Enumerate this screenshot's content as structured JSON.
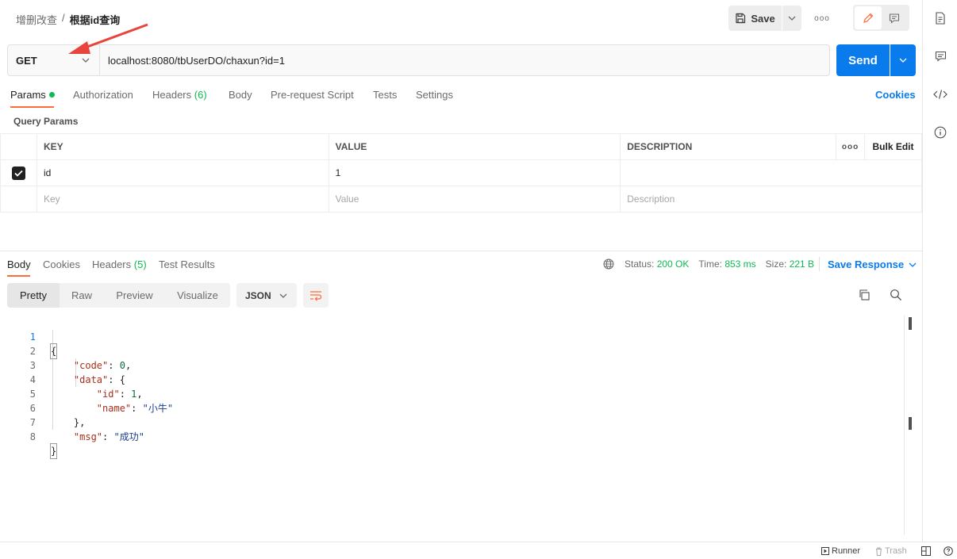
{
  "header": {
    "breadcrumb_parent": "增删改查",
    "breadcrumb_sep": "/",
    "breadcrumb_current": "根据id查询",
    "save_label": "Save",
    "more_label": "ooo"
  },
  "request": {
    "method": "GET",
    "url": "localhost:8080/tbUserDO/chaxun?id=1",
    "send_label": "Send"
  },
  "request_tabs": {
    "params": "Params",
    "authorization": "Authorization",
    "headers": "Headers",
    "headers_count": "(6)",
    "body": "Body",
    "pre_request": "Pre-request Script",
    "tests": "Tests",
    "settings": "Settings",
    "cookies": "Cookies"
  },
  "params": {
    "section_title": "Query Params",
    "col_key": "KEY",
    "col_value": "VALUE",
    "col_description": "DESCRIPTION",
    "more": "ooo",
    "bulk_edit": "Bulk Edit",
    "rows": [
      {
        "key": "id",
        "value": "1",
        "description": "",
        "checked": true
      }
    ],
    "placeholder_key": "Key",
    "placeholder_value": "Value",
    "placeholder_description": "Description"
  },
  "response_tabs": {
    "body": "Body",
    "cookies": "Cookies",
    "headers": "Headers",
    "headers_count": "(5)",
    "test_results": "Test Results"
  },
  "response_status": {
    "status_label": "Status:",
    "status_value": "200 OK",
    "time_label": "Time:",
    "time_value": "853 ms",
    "size_label": "Size:",
    "size_value": "221 B",
    "save_response": "Save Response"
  },
  "format": {
    "tabs": [
      "Pretty",
      "Raw",
      "Preview",
      "Visualize"
    ],
    "active": "Pretty",
    "language": "JSON"
  },
  "code_lines": [
    {
      "n": "1",
      "t": "{"
    },
    {
      "n": "2",
      "t": "    \"code\": 0,"
    },
    {
      "n": "3",
      "t": "    \"data\": {"
    },
    {
      "n": "4",
      "t": "        \"id\": 1,"
    },
    {
      "n": "5",
      "t": "        \"name\": \"小牛\""
    },
    {
      "n": "6",
      "t": "    },"
    },
    {
      "n": "7",
      "t": "    \"msg\": \"成功\""
    },
    {
      "n": "8",
      "t": "}"
    }
  ],
  "code_tokens": {
    "code_key": "\"code\"",
    "code_val": "0",
    "data_key": "\"data\"",
    "id_key": "\"id\"",
    "id_val": "1",
    "name_key": "\"name\"",
    "name_val": "\"小牛\"",
    "msg_key": "\"msg\"",
    "msg_val": "\"成功\""
  },
  "footer": {
    "runner": "Runner",
    "trash": "Trash"
  },
  "colors": {
    "accent_orange": "#ff6c37",
    "primary_blue": "#097bed",
    "success_green": "#0cbb52",
    "annotation_red": "#e8453c"
  }
}
